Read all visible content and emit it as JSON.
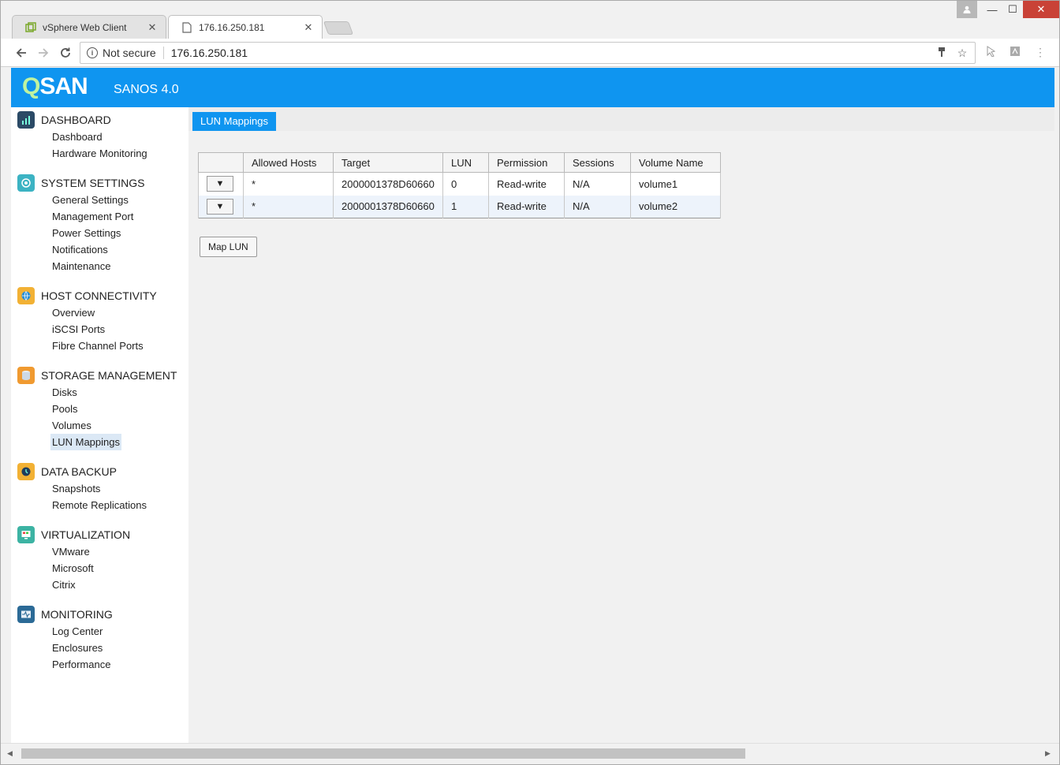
{
  "browser": {
    "tabs": [
      {
        "title": "vSphere Web Client",
        "active": false
      },
      {
        "title": "176.16.250.181",
        "active": true
      }
    ],
    "tab_close": "✕",
    "security_label": "Not secure",
    "url": "176.16.250.181",
    "window_controls": {
      "minimize": "—",
      "maximize": "☐",
      "close": "✕"
    }
  },
  "app": {
    "logo_q": "Q",
    "logo_rest": "SAN",
    "product": "SANOS 4.0"
  },
  "sidebar": {
    "sections": [
      {
        "title": "DASHBOARD",
        "icon": "dashboard-icon",
        "color": "#2b4a66",
        "items": [
          "Dashboard",
          "Hardware Monitoring"
        ]
      },
      {
        "title": "SYSTEM SETTINGS",
        "icon": "settings-icon",
        "color": "#3cb3c3",
        "items": [
          "General Settings",
          "Management Port",
          "Power Settings",
          "Notifications",
          "Maintenance"
        ]
      },
      {
        "title": "HOST CONNECTIVITY",
        "icon": "globe-icon",
        "color": "#f2b134",
        "items": [
          "Overview",
          "iSCSI Ports",
          "Fibre Channel Ports"
        ]
      },
      {
        "title": "STORAGE MANAGEMENT",
        "icon": "database-icon",
        "color": "#f09a30",
        "items": [
          "Disks",
          "Pools",
          "Volumes",
          "LUN Mappings"
        ]
      },
      {
        "title": "DATA BACKUP",
        "icon": "backup-icon",
        "color": "#f2b134",
        "items": [
          "Snapshots",
          "Remote Replications"
        ]
      },
      {
        "title": "VIRTUALIZATION",
        "icon": "monitor-icon",
        "color": "#3cb3a3",
        "items": [
          "VMware",
          "Microsoft",
          "Citrix"
        ]
      },
      {
        "title": "MONITORING",
        "icon": "pulse-icon",
        "color": "#2b6a96",
        "items": [
          "Log Center",
          "Enclosures",
          "Performance"
        ]
      }
    ],
    "active_item": "LUN Mappings"
  },
  "content": {
    "tab_label": "LUN Mappings",
    "table": {
      "columns": [
        "",
        "Allowed Hosts",
        "Target",
        "LUN",
        "Permission",
        "Sessions",
        "Volume Name"
      ],
      "rows": [
        {
          "action": "▼",
          "hosts": "*",
          "target": "2000001378D60660",
          "lun": "0",
          "permission": "Read-write",
          "sessions": "N/A",
          "volume": "volume1"
        },
        {
          "action": "▼",
          "hosts": "*",
          "target": "2000001378D60660",
          "lun": "1",
          "permission": "Read-write",
          "sessions": "N/A",
          "volume": "volume2"
        }
      ]
    },
    "map_button": "Map LUN"
  },
  "colors": {
    "banner": "#0f95f0",
    "active_tab": "#0f95f0",
    "active_item_bg": "#dbe8f5"
  }
}
